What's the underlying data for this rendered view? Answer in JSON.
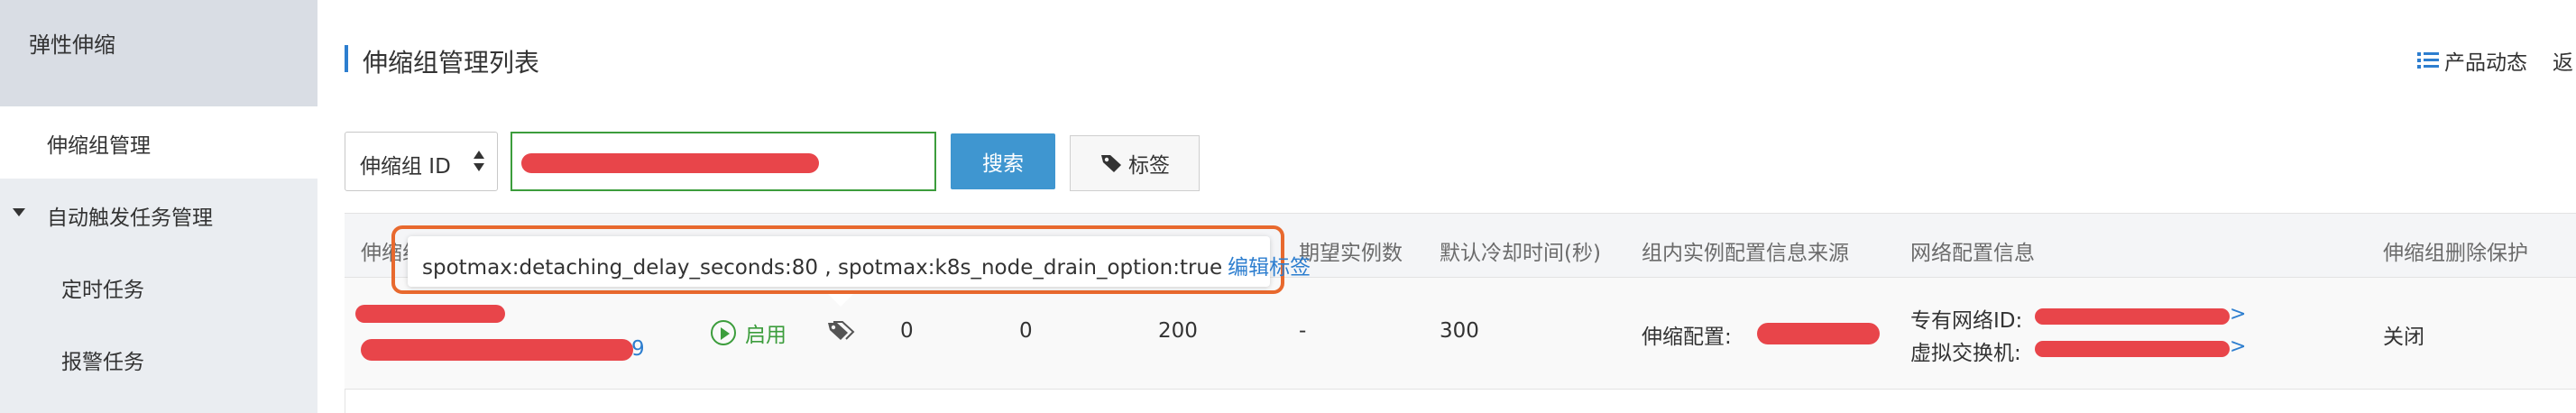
{
  "sidebar": {
    "title": "弹性伸缩",
    "items": [
      {
        "label": "伸缩组管理"
      },
      {
        "label": "自动触发任务管理"
      },
      {
        "label": "定时任务"
      },
      {
        "label": "报警任务"
      }
    ]
  },
  "header": {
    "title": "伸缩组管理列表",
    "news_label": "产品动态",
    "back_label": "返"
  },
  "filter": {
    "select_value": "伸缩组 ID",
    "search_button": "搜索",
    "tag_button": "标签"
  },
  "table": {
    "columns": [
      "伸缩组",
      "期望实例数",
      "默认冷却时间(秒)",
      "组内实例配置信息来源",
      "网络配置信息",
      "伸缩组删除保护"
    ],
    "row": {
      "status": "启用",
      "col_a": "0",
      "col_b": "0",
      "col_c": "200",
      "desired": "-",
      "cooldown": "300",
      "config_source_label": "伸缩配置:",
      "vpc_label": "专有网络ID:",
      "vswitch_label": "虚拟交换机:",
      "deletion_protection": "关闭"
    }
  },
  "tooltip": {
    "tags_text": "spotmax:detaching_delay_seconds:80 , spotmax:k8s_node_drain_option:true",
    "edit_link": "编辑标签"
  },
  "icons": {
    "tag": "tag-icon",
    "play": "play-circle-icon",
    "news": "list-icon",
    "select_arrow": "sort-arrows-icon"
  },
  "colors": {
    "accent": "#2d7ecf",
    "search_button": "#3f96d0",
    "enabled_green": "#3c9d3c",
    "highlight_orange": "#e8692e",
    "redaction_red": "#e8454a"
  }
}
